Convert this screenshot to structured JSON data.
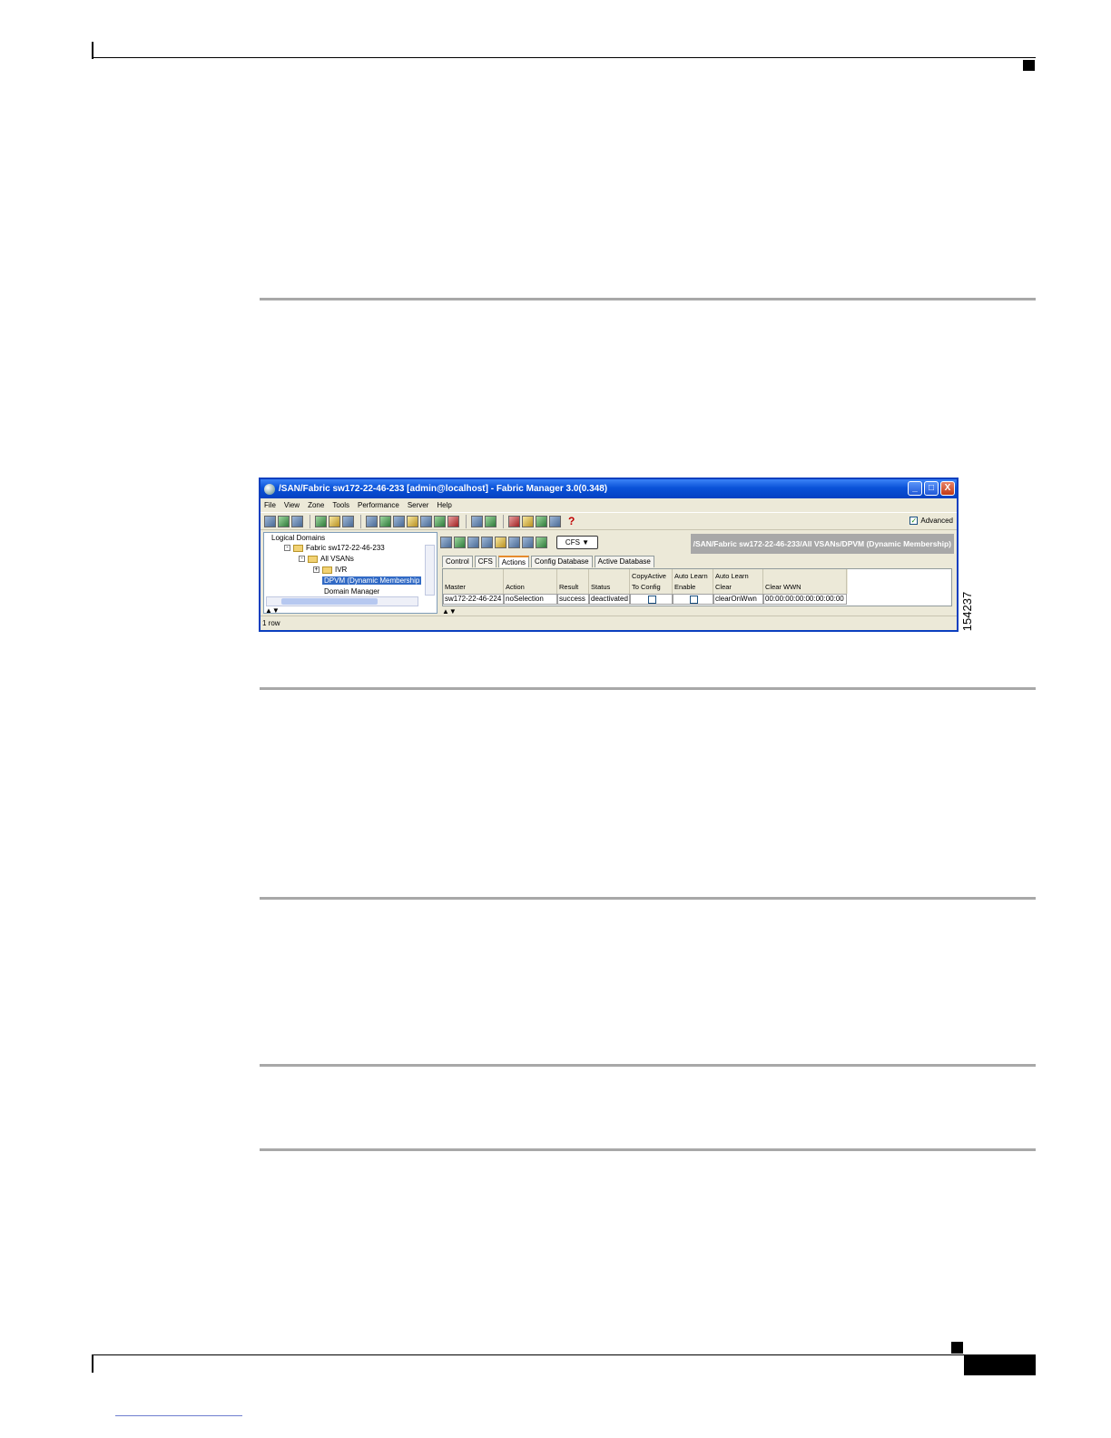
{
  "figure": {
    "id": "154237"
  },
  "window": {
    "title": "/SAN/Fabric sw172-22-46-233 [admin@localhost] - Fabric Manager 3.0(0.348)",
    "buttons": {
      "minimize": "_",
      "maximize": "□",
      "close": "X"
    }
  },
  "menu": [
    "File",
    "View",
    "Zone",
    "Tools",
    "Performance",
    "Server",
    "Help"
  ],
  "toolbar": {
    "advanced_label": "Advanced",
    "advanced_checked": true,
    "help_glyph": "?"
  },
  "left_pane": {
    "label": "Logical Domains",
    "tree": [
      {
        "expander": "-",
        "label": "Fabric sw172-22-46-233"
      },
      {
        "expander": "-",
        "label": "All VSANs"
      },
      {
        "expander": "+",
        "label": "IVR"
      },
      {
        "label": "DPVM (Dynamic Membership"
      },
      {
        "label": "Domain Manager"
      }
    ],
    "scroll_arrows": "▲▼"
  },
  "right_pane": {
    "path": "/SAN/Fabric sw172-22-46-233/All VSANs/DPVM (Dynamic Membership)",
    "cfs_button": "CFS ▼",
    "tabs": [
      "Control",
      "CFS",
      "Actions",
      "Config Database",
      "Active Database"
    ],
    "active_tab": "Actions",
    "columns": [
      {
        "line1": "",
        "line2": "Master"
      },
      {
        "line1": "",
        "line2": "Action"
      },
      {
        "line1": "",
        "line2": "Result"
      },
      {
        "line1": "",
        "line2": "Status"
      },
      {
        "line1": "CopyActive",
        "line2": "To Config"
      },
      {
        "line1": "Auto Learn",
        "line2": "Enable"
      },
      {
        "line1": "Auto Learn",
        "line2": "Clear"
      },
      {
        "line1": "",
        "line2": "Clear WWN"
      }
    ],
    "row": {
      "master": "sw172-22-46-224",
      "action": "noSelection",
      "result": "success",
      "status": "deactivated",
      "copy_active": false,
      "auto_learn_enable": false,
      "auto_learn_clear": "clearOnWwn",
      "clear_wwn": "00:00:00:00:00:00:00:00"
    },
    "scroll_arrows": "▲▼"
  },
  "status_bar": {
    "text": "1 row"
  }
}
